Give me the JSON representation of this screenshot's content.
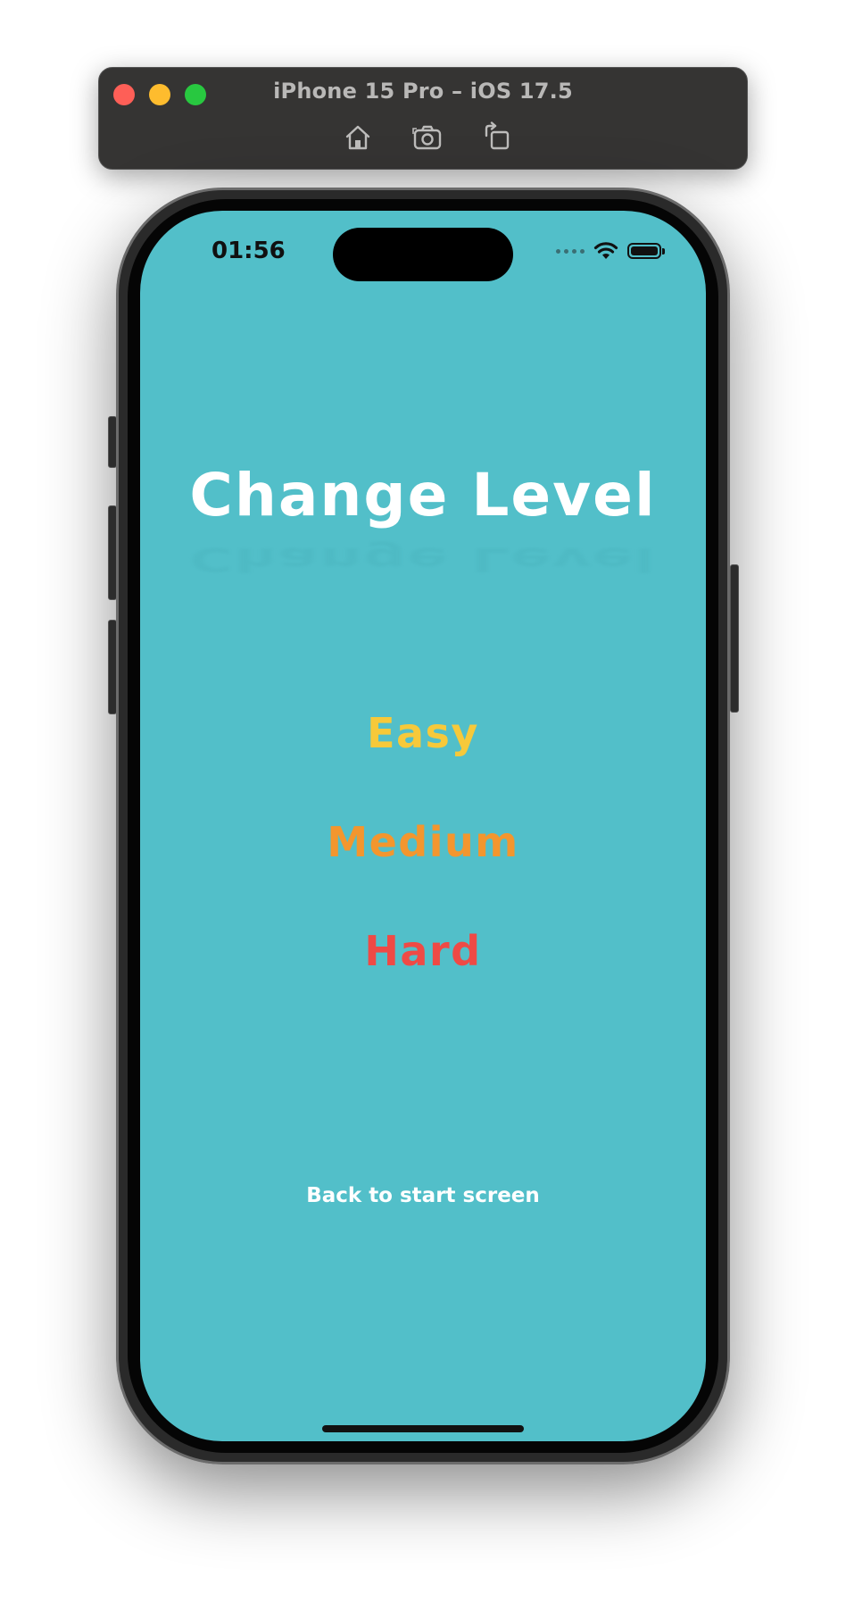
{
  "simulator": {
    "title": "iPhone 15 Pro – iOS 17.5",
    "toolbar": {
      "home_icon": "home-icon",
      "screenshot_icon": "camera-icon",
      "rotate_icon": "rotate-icon"
    },
    "traffic_lights": {
      "close_color": "#fe5f57",
      "minimize_color": "#febc2e",
      "zoom_color": "#28c840"
    }
  },
  "status_bar": {
    "time": "01:56",
    "icons": [
      "cellular-signal-icon",
      "wifi-icon",
      "battery-icon"
    ]
  },
  "screen": {
    "background_color": "#52bfc9",
    "title": "Change Level",
    "levels": [
      {
        "label": "Easy",
        "color": "#f6c93a"
      },
      {
        "label": "Medium",
        "color": "#f3962e"
      },
      {
        "label": "Hard",
        "color": "#ef4a45"
      }
    ],
    "back_label": "Back to start screen"
  }
}
